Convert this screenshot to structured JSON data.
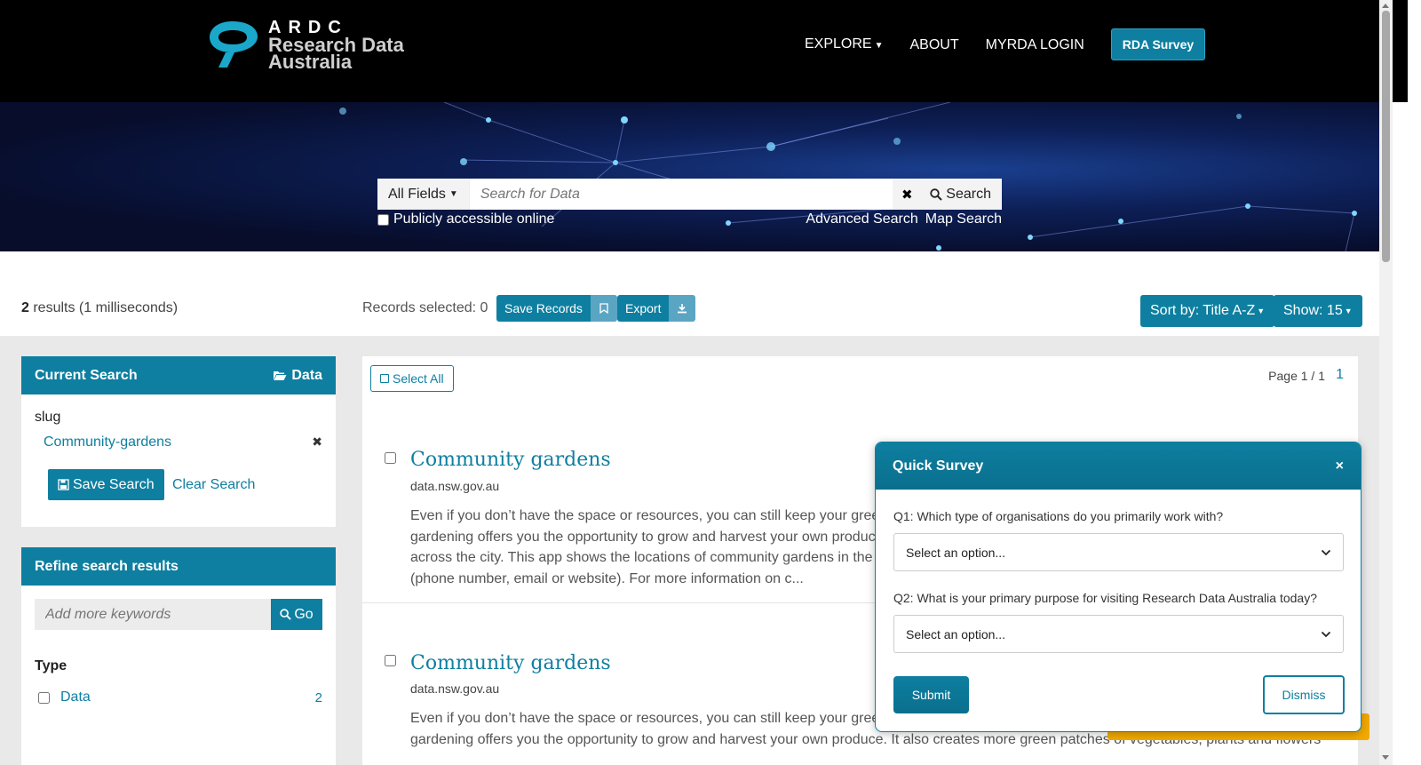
{
  "header": {
    "logo_ardc": "ARDC",
    "logo_line1": "Research Data",
    "logo_line2": "Australia",
    "nav": {
      "explore": "EXPLORE",
      "about": "ABOUT",
      "login": "MYRDA LOGIN",
      "survey": "RDA Survey"
    }
  },
  "search": {
    "field_selector": "All Fields",
    "placeholder": "Search for Data",
    "button": "Search",
    "public_checkbox": "Publicly accessible online",
    "advanced": "Advanced Search",
    "map": "Map Search"
  },
  "results_bar": {
    "count": "2",
    "count_suffix": " results (1 milliseconds)",
    "records_selected": "Records selected: 0",
    "save_records": "Save Records",
    "export": "Export",
    "sort": "Sort by: Title A-Z",
    "show": "Show: 15"
  },
  "current_search": {
    "title": "Current Search",
    "context": "Data",
    "facet_label": "slug",
    "facet_value": "Community-gardens",
    "save_search": "Save Search",
    "clear_search": "Clear Search"
  },
  "refine": {
    "title": "Refine search results",
    "placeholder": "Add more keywords",
    "go": "Go",
    "type_label": "Type",
    "types": [
      {
        "name": "Data",
        "count": "2"
      }
    ]
  },
  "results": {
    "select_all": "Select All",
    "page_info": "Page 1 / 1",
    "page_number": "1",
    "items": [
      {
        "title": "Community gardens",
        "source": "data.nsw.gov.au",
        "desc_lines": [
          "Even if you don’t have the space or resources, you can still keep your green t",
          "gardening offers you the opportunity to grow and harvest your own produce",
          "across the city. This app shows the locations of community gardens in the C",
          "(phone number, email or website). For more information on c..."
        ]
      },
      {
        "title": "Community gardens",
        "source": "data.nsw.gov.au",
        "desc_lines": [
          "Even if you don’t have the space or resources, you can still keep your green t",
          "gardening offers you the opportunity to grow and harvest your own produce. It also creates more green patches of vegetables, plants and flowers"
        ]
      }
    ]
  },
  "survey": {
    "title": "Quick Survey",
    "close": "×",
    "q1": "Q1: Which type of organisations do you primarily work with?",
    "q1_value": "Select an option...",
    "q2": "Q2: What is your primary purpose for visiting Research Data Australia today?",
    "q2_value": "Select an option...",
    "submit": "Submit",
    "dismiss": "Dismiss"
  },
  "colors": {
    "accent": "#0e7fa0",
    "header_bg": "#000000",
    "content_bg": "#e9e9e9",
    "highlight": "#f2a900"
  }
}
